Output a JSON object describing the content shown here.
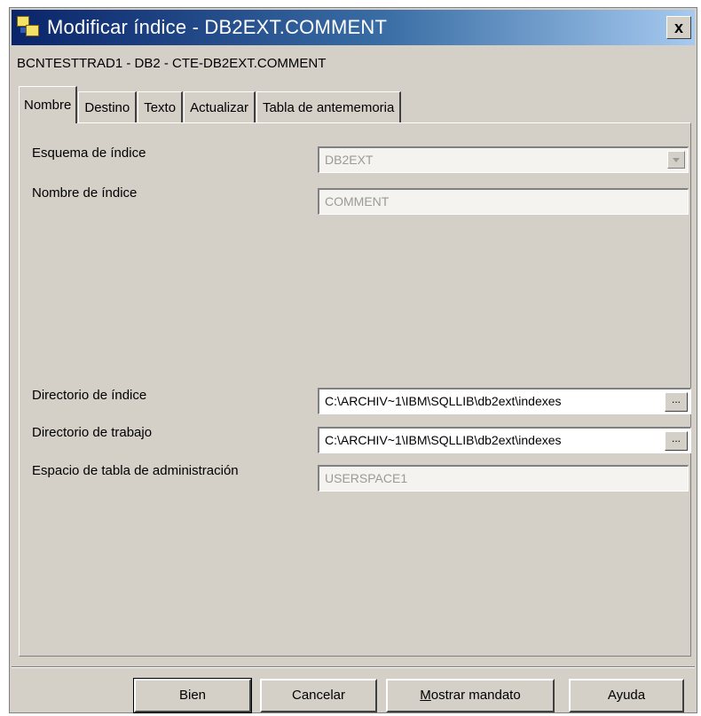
{
  "window": {
    "title": "Modificar índice - DB2EXT.COMMENT",
    "close_label": "x",
    "subtitle": "BCNTESTTRAD1 - DB2 - CTE-DB2EXT.COMMENT"
  },
  "tabs": [
    {
      "label": "Nombre",
      "active": true
    },
    {
      "label": "Destino"
    },
    {
      "label": "Texto"
    },
    {
      "label": "Actualizar"
    },
    {
      "label": "Tabla de antememoria"
    }
  ],
  "form": {
    "schema_label": "Esquema de índice",
    "schema_value": "DB2EXT",
    "name_label": "Nombre de índice",
    "name_value": "COMMENT",
    "index_dir_label": "Directorio de índice",
    "index_dir_value": "C:\\ARCHIV~1\\IBM\\SQLLIB\\db2ext\\indexes",
    "work_dir_label": "Directorio de trabajo",
    "work_dir_value": "C:\\ARCHIV~1\\IBM\\SQLLIB\\db2ext\\indexes",
    "admin_ts_label": "Espacio de tabla de administración",
    "admin_ts_value": "USERSPACE1",
    "browse_label": "..."
  },
  "buttons": {
    "ok": "Bien",
    "cancel": "Cancelar",
    "show_command_first": "M",
    "show_command_rest": "ostrar mandato",
    "help": "Ayuda"
  }
}
